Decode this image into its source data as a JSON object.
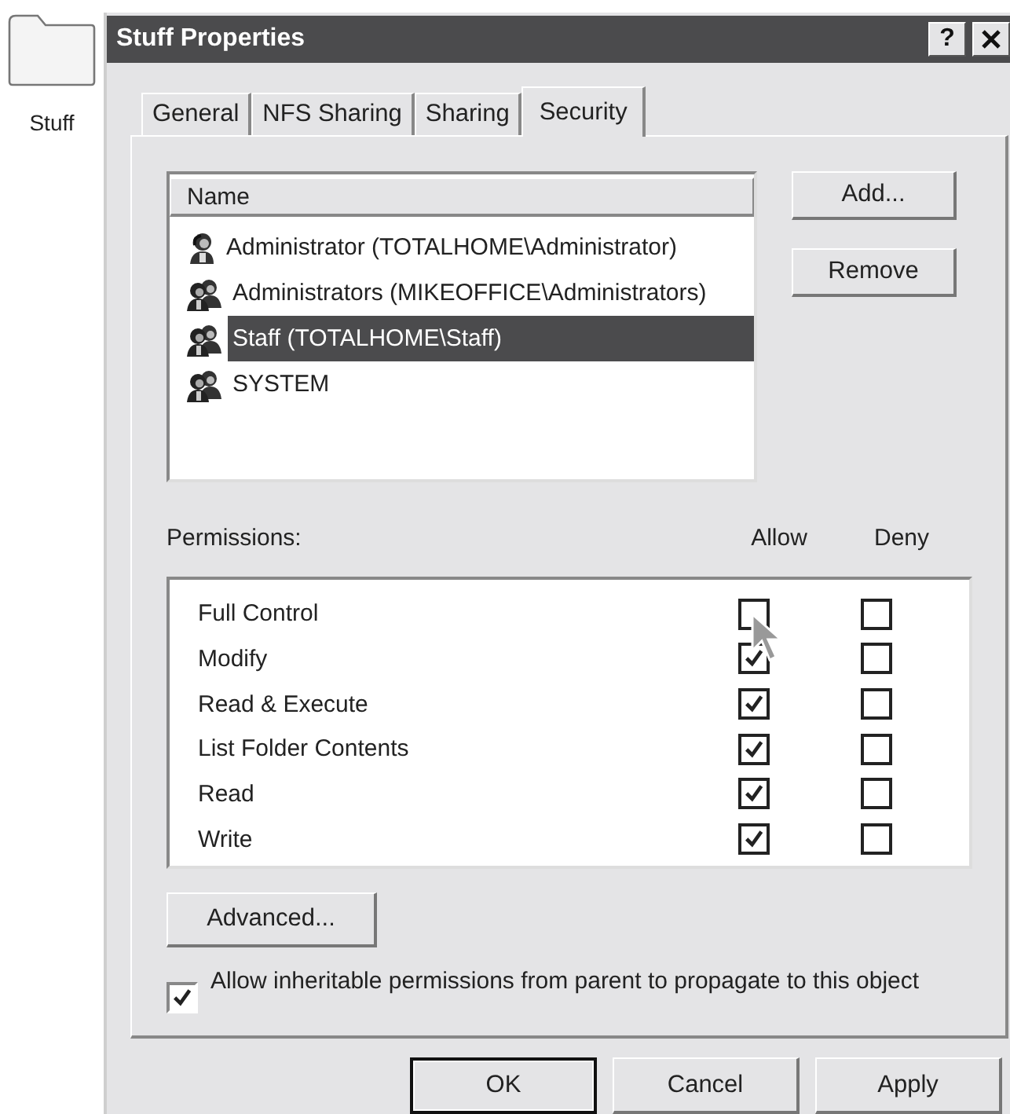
{
  "desktop_icon": {
    "label": "Stuff"
  },
  "window": {
    "title": "Stuff Properties",
    "help_button": "?"
  },
  "tabs": [
    {
      "label": "General",
      "selected": false
    },
    {
      "label": "NFS Sharing",
      "selected": false
    },
    {
      "label": "Sharing",
      "selected": false
    },
    {
      "label": "Security",
      "selected": true
    }
  ],
  "users": {
    "column": "Name",
    "items": [
      {
        "name": "Administrator (TOTALHOME\\Administrator)",
        "kind": "user",
        "selected": false
      },
      {
        "name": "Administrators (MIKEOFFICE\\Administrators)",
        "kind": "group",
        "selected": false
      },
      {
        "name": "Staff (TOTALHOME\\Staff)",
        "kind": "group",
        "selected": true
      },
      {
        "name": "SYSTEM",
        "kind": "group",
        "selected": false
      }
    ]
  },
  "user_buttons": [
    "Add...",
    "Remove"
  ],
  "permissions": {
    "label": "Permissions:",
    "allow_header": "Allow",
    "deny_header": "Deny",
    "rows": [
      {
        "name": "Full Control",
        "allow": false,
        "deny": false
      },
      {
        "name": "Modify",
        "allow": true,
        "deny": false
      },
      {
        "name": "Read & Execute",
        "allow": true,
        "deny": false
      },
      {
        "name": "List Folder Contents",
        "allow": true,
        "deny": false
      },
      {
        "name": "Read",
        "allow": true,
        "deny": false
      },
      {
        "name": "Write",
        "allow": true,
        "deny": false
      }
    ]
  },
  "advanced_button": "Advanced...",
  "inherit": {
    "label": "Allow inheritable permissions from parent to propagate to this object",
    "checked": true
  },
  "dialog_buttons": [
    {
      "label": "OK",
      "default": true
    },
    {
      "label": "Cancel",
      "default": false
    },
    {
      "label": "Apply",
      "default": false
    }
  ]
}
